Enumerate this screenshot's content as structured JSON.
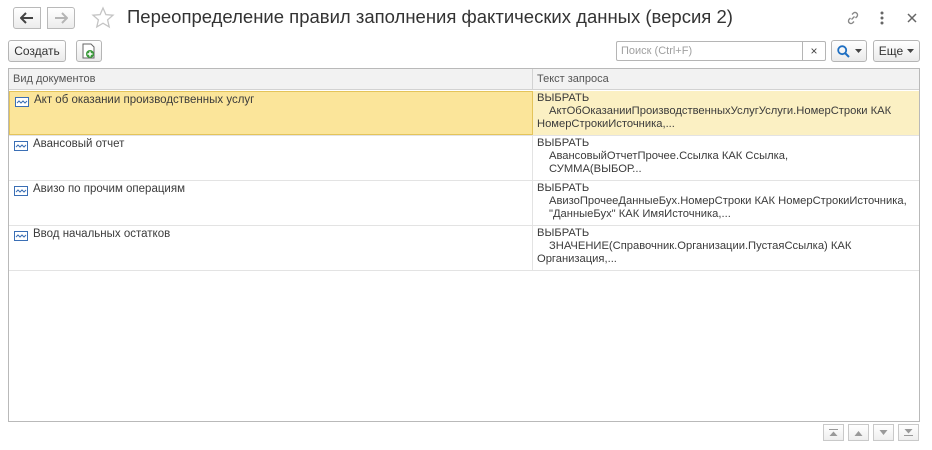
{
  "window": {
    "title": "Переопределение правил заполнения фактических данных (версия 2)"
  },
  "toolbar": {
    "create_label": "Создать",
    "search_placeholder": "Поиск (Ctrl+F)",
    "search_clear": "×",
    "more_label": "Еще"
  },
  "table": {
    "columns": [
      "Вид документов",
      "Текст запроса"
    ],
    "rows": [
      {
        "doc": "Акт об оказании производственных услуг",
        "query": [
          "ВЫБРАТЬ",
          "АктОбОказанииПроизводственныхУслугУслуги.НомерСтроки КАК",
          "НомерСтрокиИсточника,..."
        ],
        "selected": true
      },
      {
        "doc": "Авансовый отчет",
        "query": [
          "ВЫБРАТЬ",
          "АвансовыйОтчетПрочее.Ссылка КАК Ссылка,",
          "СУММА(ВЫБОР..."
        ],
        "selected": false
      },
      {
        "doc": "Авизо по прочим операциям",
        "query": [
          "ВЫБРАТЬ",
          "АвизоПрочееДанныеБух.НомерСтроки КАК НомерСтрокиИсточника,",
          "\"ДанныеБух\" КАК ИмяИсточника,..."
        ],
        "selected": false
      },
      {
        "doc": "Ввод начальных остатков",
        "query": [
          "ВЫБРАТЬ",
          "ЗНАЧЕНИЕ(Справочник.Организации.ПустаяСсылка) КАК",
          "Организация,..."
        ],
        "selected": false
      }
    ]
  },
  "icons": {
    "back": "arrow-left-icon",
    "forward": "arrow-right-icon",
    "favorite": "star-icon",
    "link": "link-icon",
    "menu": "more-vertical-icon",
    "close": "close-icon",
    "copy": "copy-add-icon",
    "search": "search-icon",
    "doc": "document-type-icon"
  },
  "colors": {
    "selected_row": "#fbf0c3",
    "selected_cell": "#fbe59a",
    "selected_border": "#e4c45a",
    "header_bg": "#f2f2f2",
    "accent_green": "#3a9a3a",
    "search_blue": "#1f6fc2"
  }
}
